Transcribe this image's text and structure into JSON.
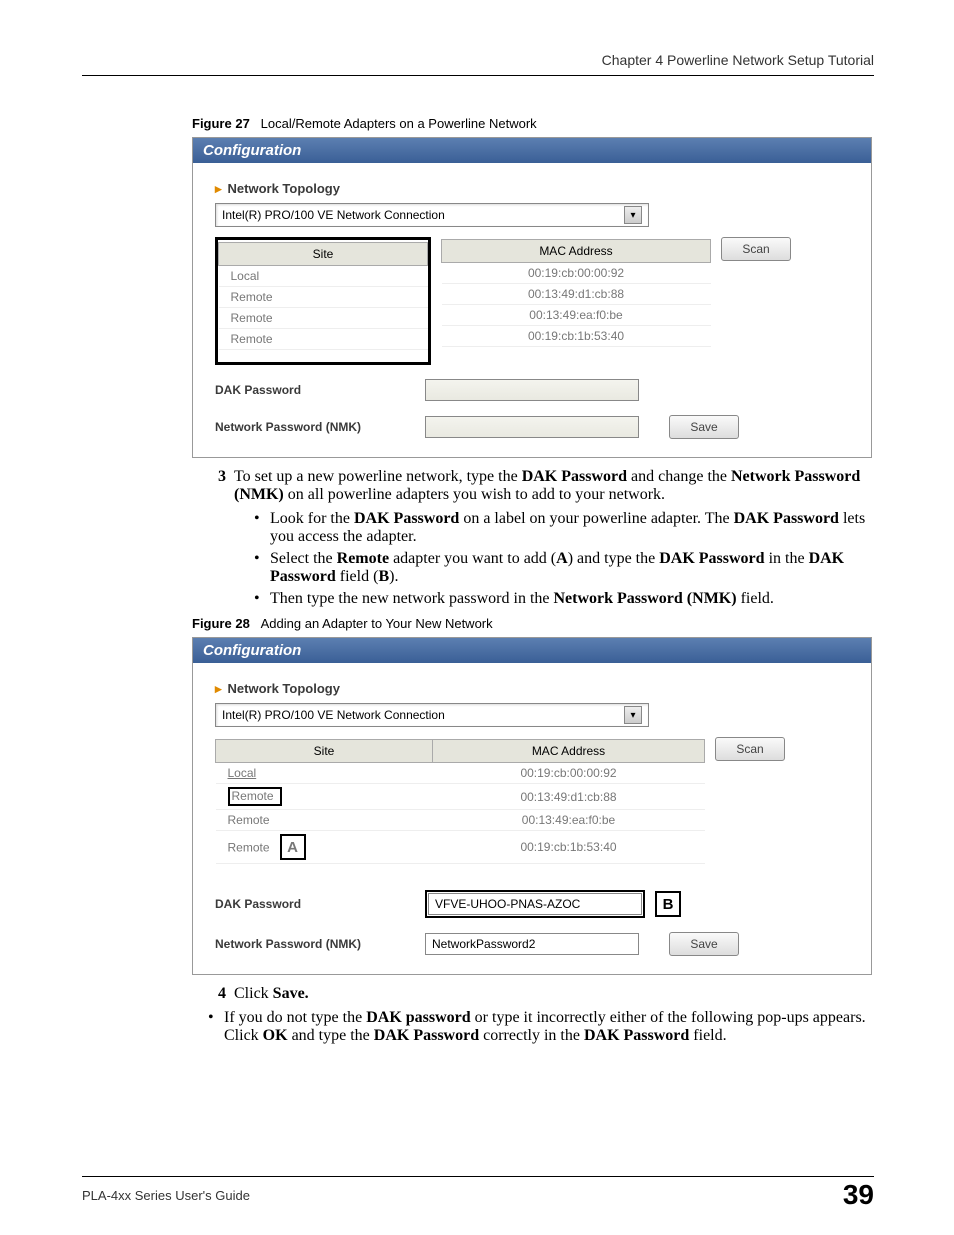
{
  "header": {
    "chapter": "Chapter 4 Powerline Network Setup Tutorial"
  },
  "fig27": {
    "caption_label": "Figure 27",
    "caption_text": "Local/Remote Adapters on a Powerline Network",
    "panel_title": "Configuration",
    "section_title": "Network Topology",
    "combobox_value": "Intel(R) PRO/100 VE Network Connection",
    "scan_label": "Scan",
    "save_label": "Save",
    "dak_label": "DAK Password",
    "nmk_label": "Network Password (NMK)",
    "dak_value": "",
    "nmk_value": "",
    "table": {
      "col_site": "Site",
      "col_mac": "MAC Address",
      "rows": [
        {
          "site": "Local",
          "mac": "00:19:cb:00:00:92"
        },
        {
          "site": "Remote",
          "mac": "00:13:49:d1:cb:88"
        },
        {
          "site": "Remote",
          "mac": "00:13:49:ea:f0:be"
        },
        {
          "site": "Remote",
          "mac": "00:19:cb:1b:53:40"
        }
      ]
    }
  },
  "step3": {
    "num": "3",
    "text_a": "To set up a new powerline network, type the ",
    "text_b": "DAK Password",
    "text_c": " and change the ",
    "text_d": "Network Password (NMK)",
    "text_e": " on all powerline adapters you wish to add to your network.",
    "b1_a": "Look for the ",
    "b1_b": "DAK Password",
    "b1_c": " on a label on your powerline adapter. The ",
    "b1_d": "DAK Password",
    "b1_e": " lets you access the adapter.",
    "b2_a": "Select the ",
    "b2_b": "Remote",
    "b2_c": " adapter you want to add (",
    "b2_d": "A",
    "b2_e": ") and type the ",
    "b2_f": "DAK Password",
    "b2_g": " in the ",
    "b2_h": "DAK Password",
    "b2_i": " field (",
    "b2_j": "B",
    "b2_k": ").",
    "b3_a": "Then type the new network password in the ",
    "b3_b": "Network Password (NMK)",
    "b3_c": " field."
  },
  "fig28": {
    "caption_label": "Figure 28",
    "caption_text": "Adding an Adapter to Your New Network",
    "panel_title": "Configuration",
    "section_title": "Network Topology",
    "combobox_value": "Intel(R) PRO/100 VE Network Connection",
    "scan_label": "Scan",
    "save_label": "Save",
    "dak_label": "DAK Password",
    "nmk_label": "Network Password (NMK)",
    "dak_value": "VFVE-UHOO-PNAS-AZOC",
    "nmk_value": "NetworkPassword2",
    "callout_a": "A",
    "callout_b": "B",
    "table": {
      "col_site": "Site",
      "col_mac": "MAC Address",
      "rows": [
        {
          "site": "Local",
          "mac": "00:19:cb:00:00:92"
        },
        {
          "site": "Remote",
          "mac": "00:13:49:d1:cb:88"
        },
        {
          "site": "Remote",
          "mac": "00:13:49:ea:f0:be"
        },
        {
          "site": "Remote",
          "mac": "00:19:cb:1b:53:40"
        }
      ]
    }
  },
  "step4": {
    "num": "4",
    "text_a": "Click ",
    "text_b": "Save.",
    "bullet_a": "If you do not type the ",
    "bullet_b": "DAK password",
    "bullet_c": " or type it incorrectly either of the following pop-ups appears. Click ",
    "bullet_d": "OK",
    "bullet_e": " and type the ",
    "bullet_f": "DAK Password",
    "bullet_g": " correctly in the ",
    "bullet_h": "DAK Password",
    "bullet_i": " field."
  },
  "footer": {
    "guide": "PLA-4xx Series User's Guide",
    "page": "39"
  }
}
